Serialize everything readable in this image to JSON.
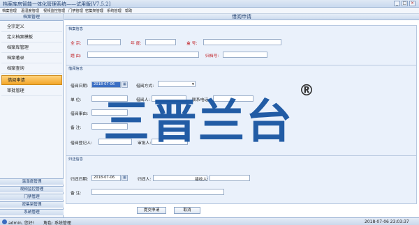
{
  "app": {
    "title": "档案库房智能一体化管理系统——试用版[V7.5.2]",
    "window_controls": [
      "_",
      "□",
      "×"
    ]
  },
  "menu": [
    "档案管理",
    "温湿度管理",
    "视频监控管理",
    "门禁管理",
    "密集架管理",
    "系统管理",
    "帮助"
  ],
  "sidebar": {
    "header": "档案管理",
    "items": [
      {
        "label": "全宗定义"
      },
      {
        "label": "定义档案模板"
      },
      {
        "label": "档案库管理"
      },
      {
        "label": "档案著录"
      },
      {
        "label": "档案查询"
      },
      {
        "label": "借阅申请",
        "active": true
      },
      {
        "label": "审批管理"
      }
    ],
    "groups": [
      "温湿度管理",
      "视频监控管理",
      "门禁管理",
      "密集架管理",
      "系统管理"
    ]
  },
  "main": {
    "title": "借阅申请",
    "archive_section": {
      "title": "档案信息",
      "fonds_label": "全 宗:",
      "fonds_value": "",
      "year_label": "年 度:",
      "year_value": "",
      "box_label": "盒 号:",
      "box_value": "",
      "subject_label": "题 由:",
      "subject_value": "",
      "file_no_label": "归档号:",
      "file_no_value": ""
    },
    "borrow_section": {
      "title": "借阅信息",
      "date_label": "借阅日期:",
      "date_value": "2018-07-06",
      "method_label": "借阅方式:",
      "method_value": "",
      "unit_label": "单 位:",
      "unit_value": "",
      "borrower_label": "借阅人:",
      "borrower_value": "",
      "phone_label": "联系电话:",
      "phone_value": "",
      "reason_label": "借阅事由:",
      "reason_value": "",
      "note_label": "备 注:",
      "note_value": "",
      "registrar_label": "借阅登记人:",
      "registrar_value": "",
      "approver_label": "审批人:",
      "approver_value": ""
    },
    "return_section": {
      "title": "归还信息",
      "return_date_label": "归还日期:",
      "return_date_value": "2018-07-06",
      "returner_label": "归还人:",
      "returner_value": "",
      "receiver_label": "接收人:",
      "receiver_value": "",
      "note_label": "备 注:",
      "note_value": ""
    },
    "buttons": {
      "submit": "提交申请",
      "cancel": "取消"
    }
  },
  "watermark": {
    "text": "三晋兰台",
    "registered": "®",
    "color": "#12509e"
  },
  "status": {
    "user": "admin, 您好!",
    "role": "角色: 系统管理",
    "datetime": "2018-07-06 23:03:37"
  },
  "colors": {
    "active_item": "#f3a62a",
    "label_red": "#c0181c",
    "brand_blue": "#12509e"
  }
}
